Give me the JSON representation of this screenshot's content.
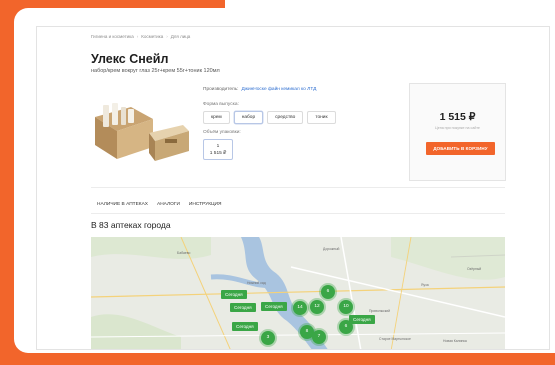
{
  "breadcrumbs": [
    "Гигиена и косметика",
    "Косметика",
    "Для лица"
  ],
  "product": {
    "title": "Улекс Снейл",
    "subtitle": "набор/крем вокруг глаз 25г+крем 55г+тоник 120мл",
    "manufacturer_label": "Производитель:",
    "manufacturer_name": "ДжинНоске файн кемикал ко ЛТД",
    "form_label": "Форма выпуска:",
    "forms": [
      "крем",
      "набор",
      "средство",
      "тоник"
    ],
    "active_form": "набор",
    "volume_label": "Объём упаковки:",
    "volume_qty": "1",
    "volume_price": "1 515 ₽"
  },
  "buy": {
    "price": "1 515 ₽",
    "note": "Цена при покупке на сайте",
    "cart_button": "ДОБАВИТЬ В КОРЗИНУ"
  },
  "tabs": [
    "НАЛИЧИЕ В АПТЕКАХ",
    "АНАЛОГИ",
    "ИНСТРУКЦИЯ"
  ],
  "availability_heading": "В 83 аптеках города",
  "map": {
    "tags": [
      "Сегодня",
      "Сегодня",
      "Сегодня",
      "Сегодня",
      "Сегодня"
    ],
    "clusters": [
      "6",
      "14",
      "12",
      "10",
      "6",
      "8",
      "7",
      "3"
    ],
    "place_labels": [
      "Бабаево",
      "Нижний сад",
      "Дорожный",
      "Яуза",
      "Приволжский",
      "Озёрный",
      "Старое Мартынское",
      "Новая Калинка"
    ]
  }
}
